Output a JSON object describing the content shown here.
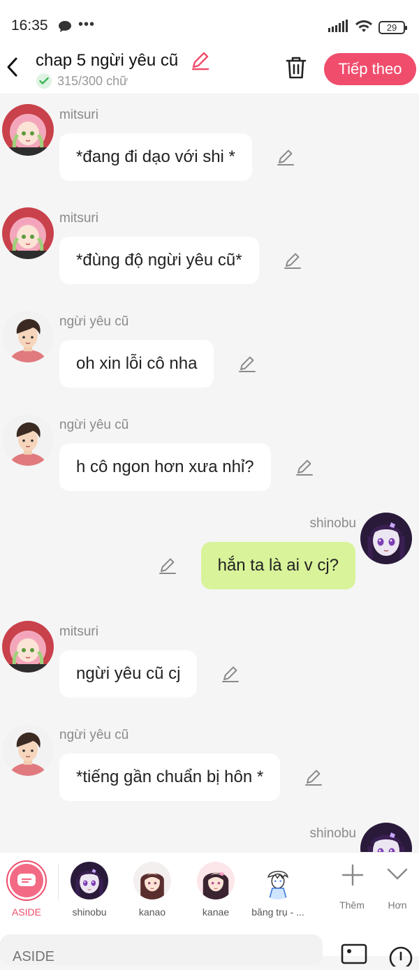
{
  "status": {
    "time": "16:35",
    "battery": "29"
  },
  "header": {
    "title": "chap 5 ngừi yêu cũ",
    "count": "315/300 chữ",
    "next_label": "Tiếp theo"
  },
  "messages": [
    {
      "side": "left",
      "avatar": "mitsuri",
      "name": "mitsuri",
      "text": "*đang đi dạo với shi *"
    },
    {
      "side": "left",
      "avatar": "mitsuri",
      "name": "mitsuri",
      "text": "*đùng độ ngừi yêu cũ*"
    },
    {
      "side": "left",
      "avatar": "ex",
      "name": "ngừi yêu cũ",
      "text": "oh xin lỗi cô nha"
    },
    {
      "side": "left",
      "avatar": "ex",
      "name": "ngừi yêu cũ",
      "text": "h cô ngon hơn xưa  nhỉ?"
    },
    {
      "side": "right",
      "avatar": "shinobu",
      "name": "shinobu",
      "text": "hắn ta là ai v cj?"
    },
    {
      "side": "left",
      "avatar": "mitsuri",
      "name": "mitsuri",
      "text": "ngừi yêu cũ cj"
    },
    {
      "side": "left",
      "avatar": "ex",
      "name": "ngừi yêu cũ",
      "text": "*tiếng gần chuẩn bị hôn *"
    },
    {
      "side": "right",
      "avatar": "shinobu",
      "name": "shinobu",
      "text": ""
    }
  ],
  "characters": {
    "aside": "ASIDE",
    "items": [
      "shinobu",
      "kanao",
      "kanae",
      "băng trụ - ..."
    ],
    "add_label": "Thêm",
    "more_label": "Hơn"
  },
  "input": {
    "placeholder": "ASIDE"
  },
  "colors": {
    "accent": "#f04d6c",
    "mine_bubble": "#d9f39a"
  }
}
